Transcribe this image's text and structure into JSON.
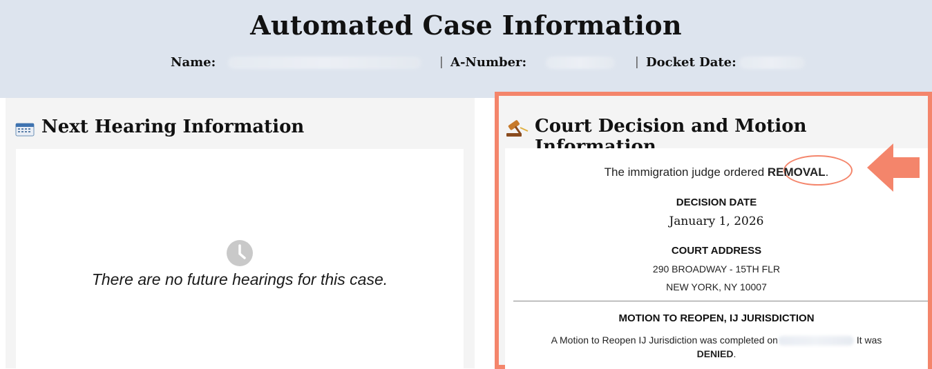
{
  "header": {
    "title": "Automated Case Information",
    "name_label": "Name:",
    "a_number_label": "A-Number:",
    "docket_date_label": "Docket Date:",
    "separator": "|"
  },
  "next_hearing": {
    "title": "Next Hearing Information",
    "message": "There are no future hearings for this case.",
    "icon": "calendar-icon",
    "message_icon": "clock-icon"
  },
  "court_decision": {
    "title": "Court Decision and Motion Information",
    "icon": "gavel-icon",
    "decision_prefix": "The immigration judge ordered ",
    "decision_value": "REMOVAL",
    "decision_suffix": ".",
    "decision_date_label": "DECISION DATE",
    "decision_date": "January 1, 2026",
    "court_address_label": "COURT ADDRESS",
    "court_address_line1": "290 BROADWAY - 15TH FLR",
    "court_address_line2": "NEW YORK, NY 10007",
    "motion_label": "MOTION TO REOPEN, IJ JURISDICTION",
    "motion_text_prefix": "A Motion to Reopen IJ Jurisdiction was completed on",
    "motion_text_suffix": " It was",
    "motion_result": "DENIED",
    "motion_result_suffix": "."
  },
  "colors": {
    "header_bg": "#dde4ee",
    "highlight": "#f4856b",
    "panel_bg": "#f4f4f4"
  }
}
